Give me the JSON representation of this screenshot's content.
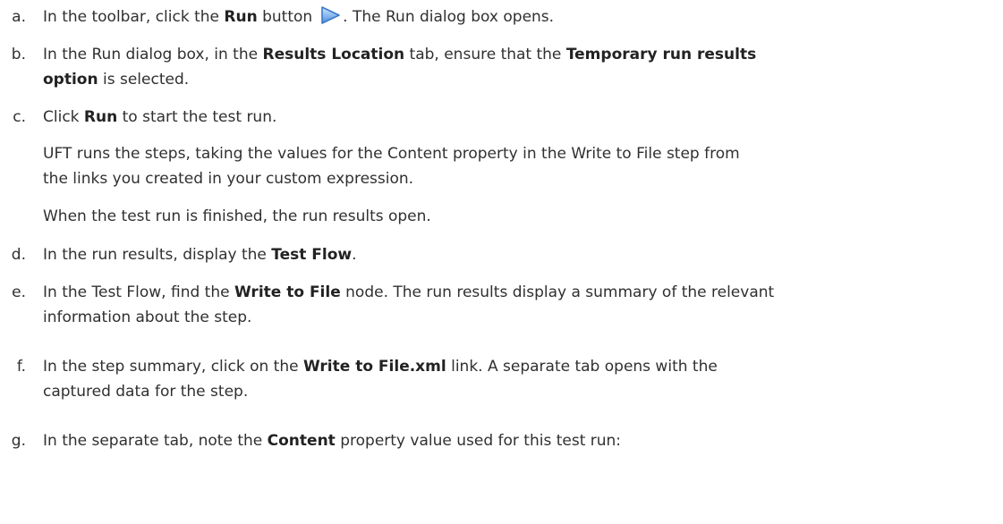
{
  "steps": [
    {
      "marker": "a.",
      "pre": "In the toolbar, click the ",
      "bold": "Run",
      "post1": " button",
      "post2": ". The Run dialog box opens."
    },
    {
      "marker": "b.",
      "pre": "In the Run dialog box, in the ",
      "bold1": "Results Location",
      "mid": " tab, ensure that the ",
      "bold2": "Temporary run results",
      "bold3": "option",
      "post": " is selected."
    },
    {
      "marker": "c.",
      "pre": "Click ",
      "bold": "Run",
      "post": " to start the test run.",
      "para1_line1": "UFT runs the steps, taking the values for the Content property in the Write to File step from",
      "para1_line2": "the links you created in your custom expression.",
      "para2": "When the test run is finished, the run results open."
    },
    {
      "marker": "d.",
      "pre": "In the run results, display the ",
      "bold": "Test Flow",
      "post": "."
    },
    {
      "marker": "e.",
      "pre": "In the Test Flow, find the ",
      "bold": "Write to File",
      "post_line1": " node. The run results display a summary of the relevant",
      "line2": "information about the step."
    },
    {
      "marker": "f.",
      "pre": "In the step summary, click on the ",
      "bold": "Write to File.xml",
      "post_line1": " link. A separate tab opens with the",
      "line2": "captured data for the step."
    },
    {
      "marker": "g.",
      "pre": "In the separate tab, note the ",
      "bold": "Content",
      "post": " property value used for this test run:"
    }
  ],
  "icons": {
    "run_button": "run-play-icon",
    "run_icon_fill": "#6fa8e6",
    "run_icon_stroke": "#3c78c8"
  }
}
